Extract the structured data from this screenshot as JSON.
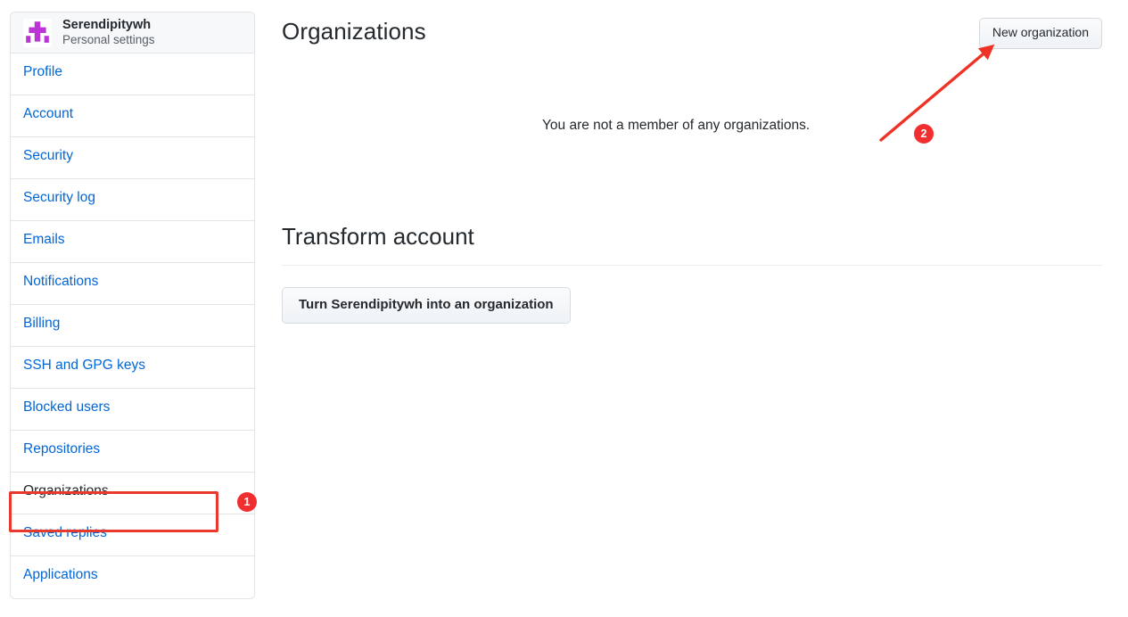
{
  "sidebar": {
    "account": {
      "avatar_icon": "identicon-avatar",
      "name": "Serendipitywh",
      "subtitle": "Personal settings",
      "avatar_color": "#b935d4"
    },
    "items": [
      {
        "label": "Profile",
        "active": false
      },
      {
        "label": "Account",
        "active": false
      },
      {
        "label": "Security",
        "active": false
      },
      {
        "label": "Security log",
        "active": false
      },
      {
        "label": "Emails",
        "active": false
      },
      {
        "label": "Notifications",
        "active": false
      },
      {
        "label": "Billing",
        "active": false
      },
      {
        "label": "SSH and GPG keys",
        "active": false
      },
      {
        "label": "Blocked users",
        "active": false
      },
      {
        "label": "Repositories",
        "active": false
      },
      {
        "label": "Organizations",
        "active": true
      },
      {
        "label": "Saved replies",
        "active": false
      },
      {
        "label": "Applications",
        "active": false
      }
    ]
  },
  "main": {
    "page_title": "Organizations",
    "new_org_button": "New organization",
    "empty_message": "You are not a member of any organizations.",
    "transform_heading": "Transform account",
    "transform_button": "Turn Serendipitywh into an organization"
  },
  "annotations": {
    "badge_1": "1",
    "badge_2": "2",
    "highlight_color": "#e8392c",
    "badge_color": "#f03030",
    "arrow_color": "#ef3226"
  },
  "theme": {
    "link_blue": "#0366d6",
    "text_primary": "#24292e",
    "text_muted": "#586069",
    "border": "#e1e4e8",
    "header_bg": "#f6f8fa"
  }
}
